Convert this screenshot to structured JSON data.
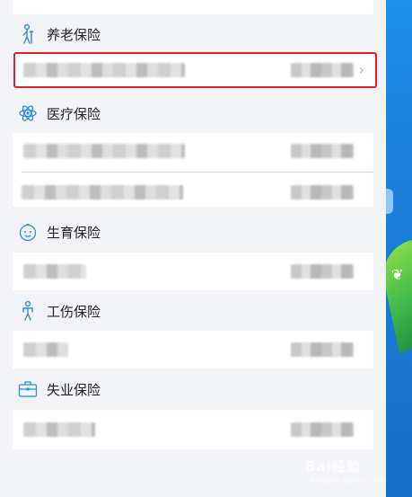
{
  "sections": [
    {
      "title": "养老保险",
      "icon": "elderly-person-icon"
    },
    {
      "title": "医疗保险",
      "icon": "atom-icon"
    },
    {
      "title": "生育保险",
      "icon": "baby-face-icon"
    },
    {
      "title": "工伤保险",
      "icon": "injured-person-icon"
    },
    {
      "title": "失业保险",
      "icon": "briefcase-icon"
    }
  ],
  "chevron": "›",
  "colors": {
    "accent_icon": "#2b8be6",
    "highlight": "#e0202a",
    "panel_bg": "#f2f4f7"
  },
  "watermark": {
    "brand": "Bai经验",
    "url": "jingyan.baidu.com"
  }
}
